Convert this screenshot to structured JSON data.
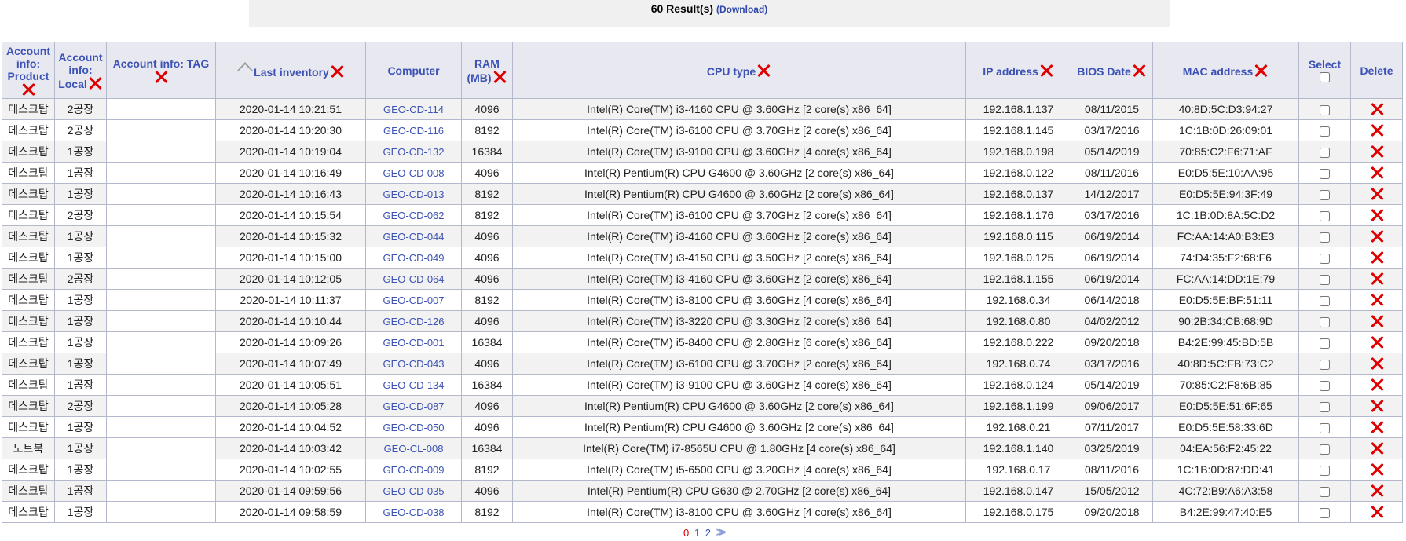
{
  "results": {
    "count_text": "60 Result(s)",
    "download_label": "(Download)"
  },
  "columns": {
    "product": "Account info: Product",
    "local": "Account info: Local",
    "tag": "Account info: TAG",
    "last_inventory": "Last inventory",
    "computer": "Computer",
    "ram": "RAM (MB)",
    "cpu": "CPU type",
    "ip": "IP address",
    "bios": "BIOS Date",
    "mac": "MAC address",
    "select": "Select",
    "delete": "Delete"
  },
  "icons": {
    "remove_column": "red-x-icon",
    "sort": "sort-up-triangle-icon",
    "delete_row": "red-x-icon"
  },
  "colors": {
    "header_text": "#3c52b5",
    "delete_red": "#e00000",
    "row_alt": "#f2f2f2"
  },
  "rows": [
    {
      "product": "데스크탑",
      "local": "2공장",
      "tag": "",
      "last": "2020-01-14 10:21:51",
      "computer": "GEO-CD-114",
      "ram": "4096",
      "cpu": "Intel(R) Core(TM) i3-4160 CPU @ 3.60GHz [2 core(s) x86_64]",
      "ip": "192.168.1.137",
      "bios": "08/11/2015",
      "mac": "40:8D:5C:D3:94:27"
    },
    {
      "product": "데스크탑",
      "local": "2공장",
      "tag": "",
      "last": "2020-01-14 10:20:30",
      "computer": "GEO-CD-116",
      "ram": "8192",
      "cpu": "Intel(R) Core(TM) i3-6100 CPU @ 3.70GHz [2 core(s) x86_64]",
      "ip": "192.168.1.145",
      "bios": "03/17/2016",
      "mac": "1C:1B:0D:26:09:01"
    },
    {
      "product": "데스크탑",
      "local": "1공장",
      "tag": "",
      "last": "2020-01-14 10:19:04",
      "computer": "GEO-CD-132",
      "ram": "16384",
      "cpu": "Intel(R) Core(TM) i3-9100 CPU @ 3.60GHz [4 core(s) x86_64]",
      "ip": "192.168.0.198",
      "bios": "05/14/2019",
      "mac": "70:85:C2:F6:71:AF"
    },
    {
      "product": "데스크탑",
      "local": "1공장",
      "tag": "",
      "last": "2020-01-14 10:16:49",
      "computer": "GEO-CD-008",
      "ram": "4096",
      "cpu": "Intel(R) Pentium(R) CPU G4600 @ 3.60GHz [2 core(s) x86_64]",
      "ip": "192.168.0.122",
      "bios": "08/11/2016",
      "mac": "E0:D5:5E:10:AA:95"
    },
    {
      "product": "데스크탑",
      "local": "1공장",
      "tag": "",
      "last": "2020-01-14 10:16:43",
      "computer": "GEO-CD-013",
      "ram": "8192",
      "cpu": "Intel(R) Pentium(R) CPU G4600 @ 3.60GHz [2 core(s) x86_64]",
      "ip": "192.168.0.137",
      "bios": "14/12/2017",
      "mac": "E0:D5:5E:94:3F:49"
    },
    {
      "product": "데스크탑",
      "local": "2공장",
      "tag": "",
      "last": "2020-01-14 10:15:54",
      "computer": "GEO-CD-062",
      "ram": "8192",
      "cpu": "Intel(R) Core(TM) i3-6100 CPU @ 3.70GHz [2 core(s) x86_64]",
      "ip": "192.168.1.176",
      "bios": "03/17/2016",
      "mac": "1C:1B:0D:8A:5C:D2"
    },
    {
      "product": "데스크탑",
      "local": "1공장",
      "tag": "",
      "last": "2020-01-14 10:15:32",
      "computer": "GEO-CD-044",
      "ram": "4096",
      "cpu": "Intel(R) Core(TM) i3-4160 CPU @ 3.60GHz [2 core(s) x86_64]",
      "ip": "192.168.0.115",
      "bios": "06/19/2014",
      "mac": "FC:AA:14:A0:B3:E3"
    },
    {
      "product": "데스크탑",
      "local": "1공장",
      "tag": "",
      "last": "2020-01-14 10:15:00",
      "computer": "GEO-CD-049",
      "ram": "4096",
      "cpu": "Intel(R) Core(TM) i3-4150 CPU @ 3.50GHz [2 core(s) x86_64]",
      "ip": "192.168.0.125",
      "bios": "06/19/2014",
      "mac": "74:D4:35:F2:68:F6"
    },
    {
      "product": "데스크탑",
      "local": "2공장",
      "tag": "",
      "last": "2020-01-14 10:12:05",
      "computer": "GEO-CD-064",
      "ram": "4096",
      "cpu": "Intel(R) Core(TM) i3-4160 CPU @ 3.60GHz [2 core(s) x86_64]",
      "ip": "192.168.1.155",
      "bios": "06/19/2014",
      "mac": "FC:AA:14:DD:1E:79"
    },
    {
      "product": "데스크탑",
      "local": "1공장",
      "tag": "",
      "last": "2020-01-14 10:11:37",
      "computer": "GEO-CD-007",
      "ram": "8192",
      "cpu": "Intel(R) Core(TM) i3-8100 CPU @ 3.60GHz [4 core(s) x86_64]",
      "ip": "192.168.0.34",
      "bios": "06/14/2018",
      "mac": "E0:D5:5E:BF:51:11"
    },
    {
      "product": "데스크탑",
      "local": "1공장",
      "tag": "",
      "last": "2020-01-14 10:10:44",
      "computer": "GEO-CD-126",
      "ram": "4096",
      "cpu": "Intel(R) Core(TM) i3-3220 CPU @ 3.30GHz [2 core(s) x86_64]",
      "ip": "192.168.0.80",
      "bios": "04/02/2012",
      "mac": "90:2B:34:CB:68:9D"
    },
    {
      "product": "데스크탑",
      "local": "1공장",
      "tag": "",
      "last": "2020-01-14 10:09:26",
      "computer": "GEO-CD-001",
      "ram": "16384",
      "cpu": "Intel(R) Core(TM) i5-8400 CPU @ 2.80GHz [6 core(s) x86_64]",
      "ip": "192.168.0.222",
      "bios": "09/20/2018",
      "mac": "B4:2E:99:45:BD:5B"
    },
    {
      "product": "데스크탑",
      "local": "1공장",
      "tag": "",
      "last": "2020-01-14 10:07:49",
      "computer": "GEO-CD-043",
      "ram": "4096",
      "cpu": "Intel(R) Core(TM) i3-6100 CPU @ 3.70GHz [2 core(s) x86_64]",
      "ip": "192.168.0.74",
      "bios": "03/17/2016",
      "mac": "40:8D:5C:FB:73:C2"
    },
    {
      "product": "데스크탑",
      "local": "1공장",
      "tag": "",
      "last": "2020-01-14 10:05:51",
      "computer": "GEO-CD-134",
      "ram": "16384",
      "cpu": "Intel(R) Core(TM) i3-9100 CPU @ 3.60GHz [4 core(s) x86_64]",
      "ip": "192.168.0.124",
      "bios": "05/14/2019",
      "mac": "70:85:C2:F8:6B:85"
    },
    {
      "product": "데스크탑",
      "local": "2공장",
      "tag": "",
      "last": "2020-01-14 10:05:28",
      "computer": "GEO-CD-087",
      "ram": "4096",
      "cpu": "Intel(R) Pentium(R) CPU G4600 @ 3.60GHz [2 core(s) x86_64]",
      "ip": "192.168.1.199",
      "bios": "09/06/2017",
      "mac": "E0:D5:5E:51:6F:65"
    },
    {
      "product": "데스크탑",
      "local": "1공장",
      "tag": "",
      "last": "2020-01-14 10:04:52",
      "computer": "GEO-CD-050",
      "ram": "4096",
      "cpu": "Intel(R) Pentium(R) CPU G4600 @ 3.60GHz [2 core(s) x86_64]",
      "ip": "192.168.0.21",
      "bios": "07/11/2017",
      "mac": "E0:D5:5E:58:33:6D"
    },
    {
      "product": "노트북",
      "local": "1공장",
      "tag": "",
      "last": "2020-01-14 10:03:42",
      "computer": "GEO-CL-008",
      "ram": "16384",
      "cpu": "Intel(R) Core(TM) i7-8565U CPU @ 1.80GHz [4 core(s) x86_64]",
      "ip": "192.168.1.140",
      "bios": "03/25/2019",
      "mac": "04:EA:56:F2:45:22"
    },
    {
      "product": "데스크탑",
      "local": "1공장",
      "tag": "",
      "last": "2020-01-14 10:02:55",
      "computer": "GEO-CD-009",
      "ram": "8192",
      "cpu": "Intel(R) Core(TM) i5-6500 CPU @ 3.20GHz [4 core(s) x86_64]",
      "ip": "192.168.0.17",
      "bios": "08/11/2016",
      "mac": "1C:1B:0D:87:DD:41"
    },
    {
      "product": "데스크탑",
      "local": "1공장",
      "tag": "",
      "last": "2020-01-14 09:59:56",
      "computer": "GEO-CD-035",
      "ram": "4096",
      "cpu": "Intel(R) Pentium(R) CPU G630 @ 2.70GHz [2 core(s) x86_64]",
      "ip": "192.168.0.147",
      "bios": "15/05/2012",
      "mac": "4C:72:B9:A6:A3:58"
    },
    {
      "product": "데스크탑",
      "local": "1공장",
      "tag": "",
      "last": "2020-01-14 09:58:59",
      "computer": "GEO-CD-038",
      "ram": "8192",
      "cpu": "Intel(R) Core(TM) i3-8100 CPU @ 3.60GHz [4 core(s) x86_64]",
      "ip": "192.168.0.175",
      "bios": "09/20/2018",
      "mac": "B4:2E:99:47:40:E5"
    }
  ],
  "pagination": {
    "current": "0",
    "pages": [
      "1",
      "2"
    ],
    "next_label": ">>"
  }
}
